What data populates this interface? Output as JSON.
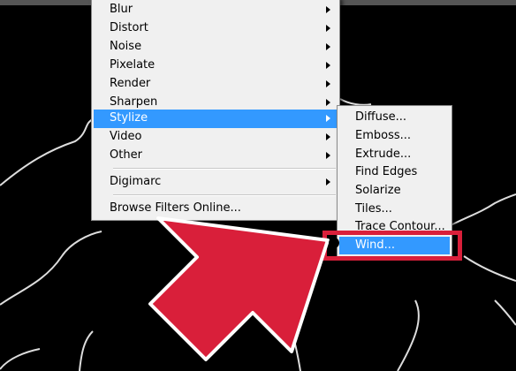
{
  "filter_menu": {
    "items": [
      {
        "label": "Blur",
        "has_submenu": true
      },
      {
        "label": "Distort",
        "has_submenu": true
      },
      {
        "label": "Noise",
        "has_submenu": true
      },
      {
        "label": "Pixelate",
        "has_submenu": true
      },
      {
        "label": "Render",
        "has_submenu": true
      },
      {
        "label": "Sharpen",
        "has_submenu": true
      },
      {
        "label": "Stylize",
        "has_submenu": true,
        "active": true
      },
      {
        "label": "Video",
        "has_submenu": true
      },
      {
        "label": "Other",
        "has_submenu": true
      },
      {
        "label": "Digimarc",
        "has_submenu": true
      },
      {
        "label": "Browse Filters Online...",
        "has_submenu": false
      }
    ]
  },
  "stylize_submenu": {
    "items": [
      {
        "label": "Diffuse..."
      },
      {
        "label": "Emboss..."
      },
      {
        "label": "Extrude..."
      },
      {
        "label": "Find Edges"
      },
      {
        "label": "Solarize"
      },
      {
        "label": "Tiles..."
      },
      {
        "label": "Trace Contour..."
      },
      {
        "label": "Wind...",
        "active": true
      }
    ]
  },
  "colors": {
    "highlight": "#3399ff",
    "annotation_red": "#d91f3a",
    "menu_bg": "#f0f0f0",
    "canvas_bg": "#000000"
  },
  "icons": {
    "submenu_arrow": "chevron-right-icon",
    "annotation": "arrow-pointer-icon"
  }
}
